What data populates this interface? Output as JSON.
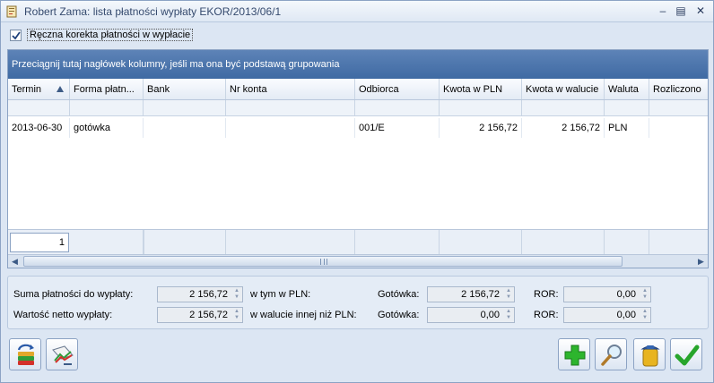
{
  "window": {
    "title": "Robert Zama: lista płatności wypłaty EKOR/2013/06/1"
  },
  "options": {
    "manual_correction_label": "Ręczna korekta płatności w wypłacie",
    "manual_correction_checked": true
  },
  "grid": {
    "group_hint": "Przeciągnij tutaj nagłówek kolumny, jeśli ma ona być podstawą grupowania",
    "columns": [
      "Termin",
      "Forma płatn...",
      "Bank",
      "Nr konta",
      "Odbiorca",
      "Kwota w PLN",
      "Kwota w walucie",
      "Waluta",
      "Rozliczono"
    ],
    "sorted_column": "Termin",
    "rows": [
      {
        "termin": "2013-06-30",
        "forma": "gotówka",
        "bank": "",
        "nr_konta": "",
        "odbiorca": "001/E",
        "kwota_pln": "2 156,72",
        "kwota_waluta": "2 156,72",
        "waluta": "PLN",
        "rozliczono": ""
      }
    ],
    "row_count": "1"
  },
  "summary": {
    "suma_label": "Suma płatności do wypłaty:",
    "suma_value": "2 156,72",
    "netto_label": "Wartość netto wypłaty:",
    "netto_value": "2 156,72",
    "w_tym_label": "w tym w PLN:",
    "w_walucie_label": "w walucie innej niż PLN:",
    "gotowka_label_1": "Gotówka:",
    "gotowka_value_1": "2 156,72",
    "gotowka_label_2": "Gotówka:",
    "gotowka_value_2": "0,00",
    "ror_label_1": "ROR:",
    "ror_value_1": "0,00",
    "ror_label_2": "ROR:",
    "ror_value_2": "0,00"
  },
  "icons": {
    "left_buttons": [
      "refresh-stack-icon",
      "chart-edit-icon"
    ],
    "right_buttons": [
      "add-plus-icon",
      "magnifier-icon",
      "trash-bin-icon",
      "checkmark-icon"
    ]
  },
  "colors": {
    "group_bar": "#4a74ad",
    "window_bg": "#dce6f3",
    "add_green": "#2db52d",
    "ok_green": "#27a52b"
  }
}
